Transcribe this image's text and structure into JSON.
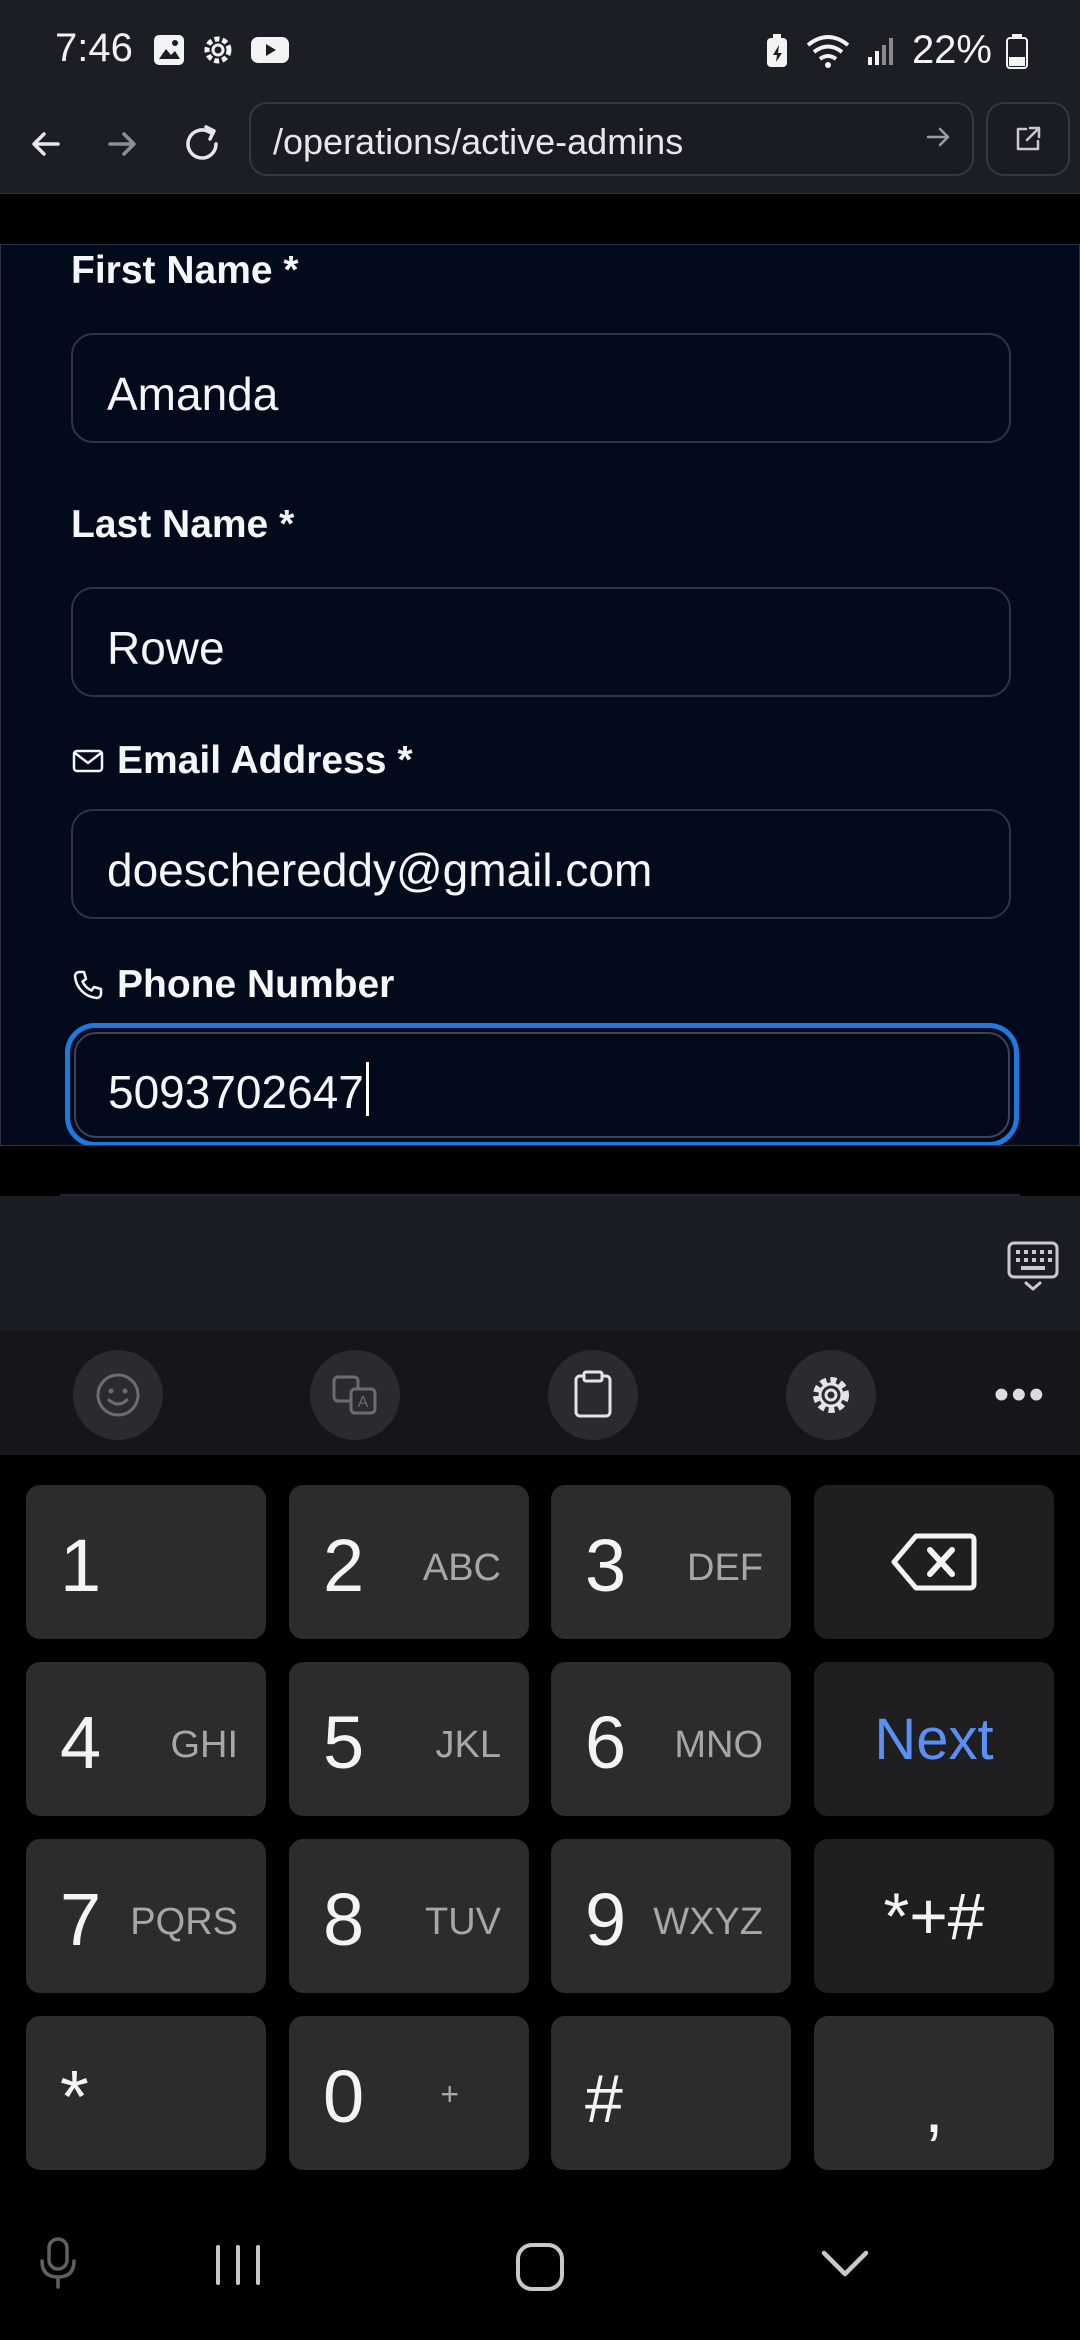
{
  "status_bar": {
    "time": "7:46",
    "battery_percent": "22%",
    "left_icons": [
      "gallery-icon",
      "settings-icon",
      "youtube-icon"
    ],
    "right_icons": [
      "battery-saver-icon",
      "wifi-icon",
      "signal-icon",
      "battery-icon"
    ]
  },
  "browser": {
    "url": "/operations/active-admins"
  },
  "form": {
    "first_name": {
      "label": "First Name *",
      "value": "Amanda"
    },
    "last_name": {
      "label": "Last Name *",
      "value": "Rowe"
    },
    "email": {
      "label": "Email Address *",
      "value": "doeschereddy@gmail.com",
      "icon": "mail-icon"
    },
    "phone": {
      "label": "Phone Number",
      "value": "5093702647",
      "icon": "phone-icon",
      "focused": true
    }
  },
  "keyboard": {
    "keys": [
      {
        "digit": "1",
        "letters": ""
      },
      {
        "digit": "2",
        "letters": "ABC"
      },
      {
        "digit": "3",
        "letters": "DEF"
      },
      {
        "digit": "4",
        "letters": "GHI"
      },
      {
        "digit": "5",
        "letters": "JKL"
      },
      {
        "digit": "6",
        "letters": "MNO"
      },
      {
        "digit": "7",
        "letters": "PQRS"
      },
      {
        "digit": "8",
        "letters": "TUV"
      },
      {
        "digit": "9",
        "letters": "WXYZ"
      },
      {
        "digit": "0",
        "letters": "+"
      }
    ],
    "next_label": "Next",
    "symbols_label": "*+#",
    "star_label": "*",
    "hash_label": "#",
    "comma_label": ",",
    "accent_color": "#5b8ff6"
  },
  "colors": {
    "focus_ring": "#1f7ae0",
    "form_background": "#030a1c"
  }
}
